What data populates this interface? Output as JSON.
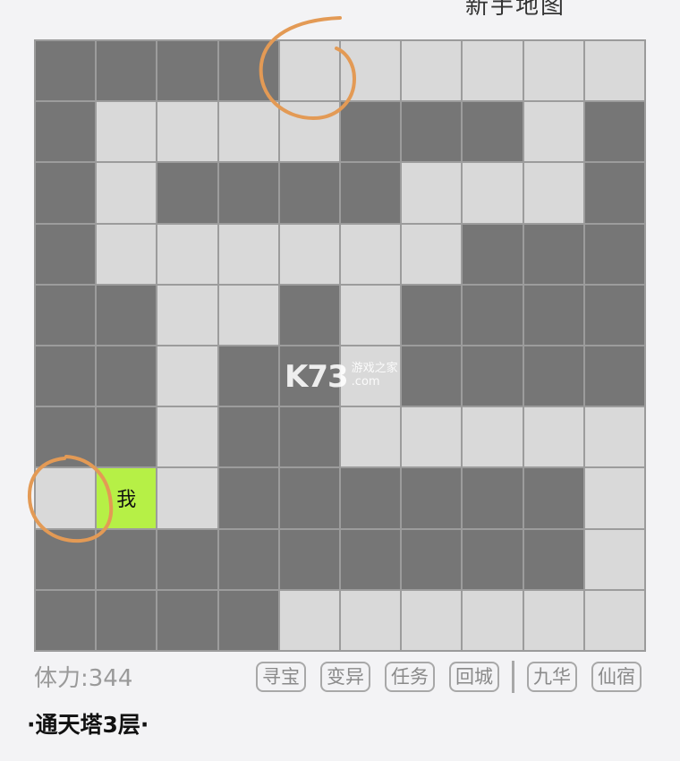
{
  "header": {
    "cut_text": "新手地图"
  },
  "maze": {
    "rows": [
      "WWWWOOOOOO",
      "WOOOOWWWOW",
      "WOWWWWOOOW",
      "WOOOOOOWWW",
      "WWOOWOWWWW",
      "WWOWWOWWWW",
      "WWOWWOOOOO",
      "OPOWWWWWWO",
      "WWWWWWWWWO",
      "WWWWOOOOOO"
    ],
    "player_label": "我",
    "colors": {
      "wall": "#767676",
      "open": "#d9d9d9",
      "player": "#b6f046",
      "circle_mark": "#e39a55"
    }
  },
  "watermark": {
    "logo": "K73",
    "cn": "游戏之家",
    "domain": ".com"
  },
  "status": {
    "stamina": "体力:344"
  },
  "buttons": [
    "寻宝",
    "变异",
    "任务",
    "回城",
    "九华",
    "仙宿"
  ],
  "floor_title": "·通天塔3层·"
}
